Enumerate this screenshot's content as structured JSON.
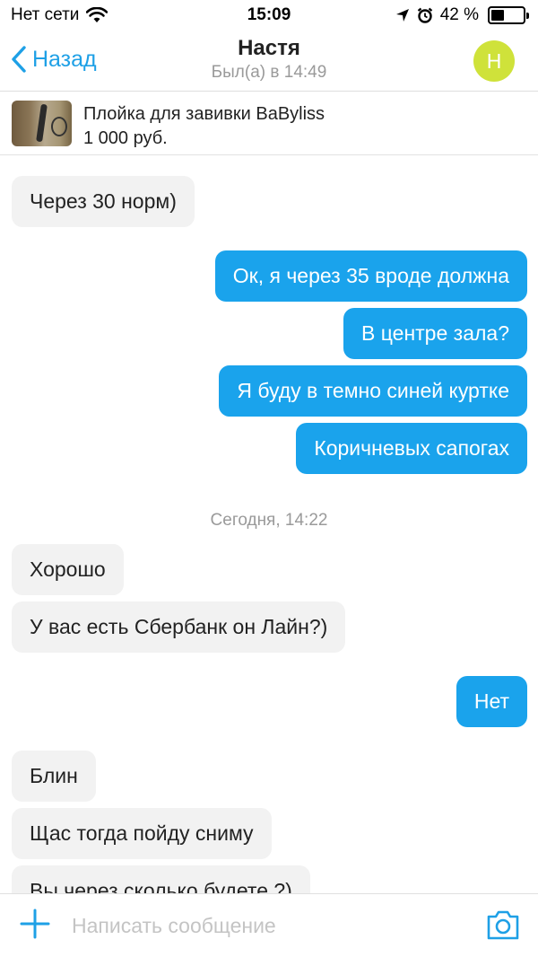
{
  "status_bar": {
    "carrier": "Нет сети",
    "time": "15:09",
    "battery": "42 %",
    "battery_level": 0.42
  },
  "header": {
    "back_label": "Назад",
    "contact_name": "Настя",
    "last_seen": "Был(а) в 14:49",
    "avatar_letter": "Н"
  },
  "listing": {
    "title": "Плойка для завивки BaByliss",
    "price": "1 000 руб."
  },
  "messages": [
    {
      "dir": "in",
      "text": "Через 30 норм)"
    },
    {
      "dir": "out",
      "text": "Ок, я через 35 вроде должна"
    },
    {
      "dir": "out",
      "text": "В центре зала?"
    },
    {
      "dir": "out",
      "text": "Я буду в темно синей куртке"
    },
    {
      "dir": "out",
      "text": "Коричневых сапогах"
    },
    {
      "dir": "date",
      "text": "Сегодня, 14:22"
    },
    {
      "dir": "in",
      "text": "Хорошо"
    },
    {
      "dir": "in",
      "text": "У вас есть Сбербанк он Лайн?)"
    },
    {
      "dir": "out",
      "text": "Нет"
    },
    {
      "dir": "in",
      "text": "Блин"
    },
    {
      "dir": "in",
      "text": "Щас тогда пойду сниму"
    },
    {
      "dir": "in",
      "text": "Вы через сколько будете ?)"
    }
  ],
  "composer": {
    "placeholder": "Написать сообщение"
  },
  "colors": {
    "accent": "#1ea0e6",
    "outgoing_bubble": "#1aa3ec",
    "incoming_bubble": "#f2f2f2",
    "avatar": "#cfe23a"
  }
}
